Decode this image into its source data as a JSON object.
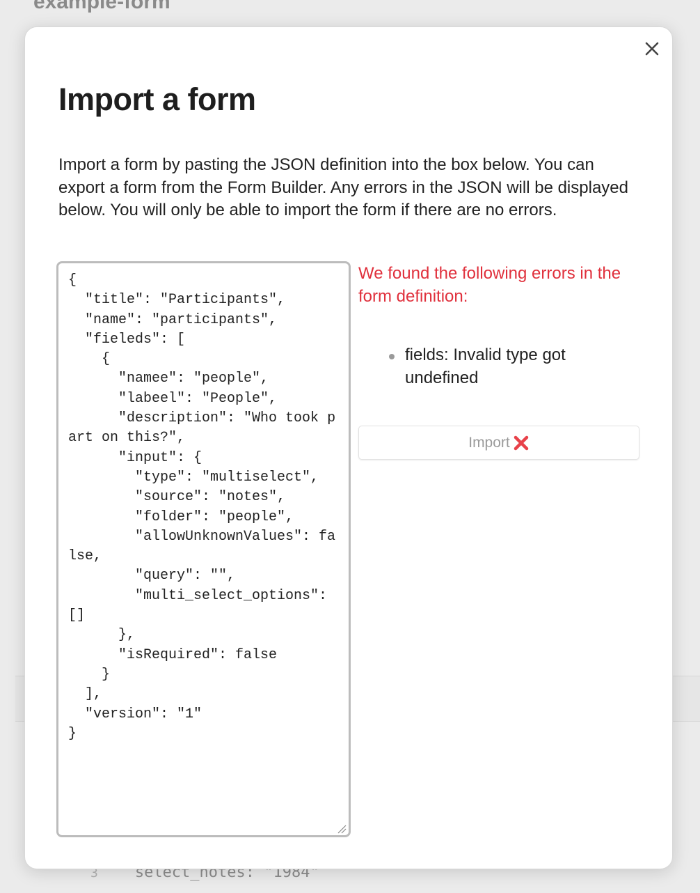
{
  "background": {
    "title": "example-form",
    "code_line_number": "3",
    "code_line_text": "select_notes: \"1984\""
  },
  "modal": {
    "close_icon": "close-icon",
    "title": "Import a form",
    "description": "Import a form by pasting the JSON definition into the box below. You can export a form from the Form Builder. Any errors in the JSON will be displayed below. You will only be able to import the form if there are no errors.",
    "json_value": "{\n  \"title\": \"Participants\",\n  \"name\": \"participants\",\n  \"fieleds\": [\n    {\n      \"namee\": \"people\",\n      \"labeel\": \"People\",\n      \"description\": \"Who took part on this?\",\n      \"input\": {\n        \"type\": \"multiselect\",\n        \"source\": \"notes\",\n        \"folder\": \"people\",\n        \"allowUnknownValues\": false,\n        \"query\": \"\",\n        \"multi_select_options\": []\n      },\n      \"isRequired\": false\n    }\n  ],\n  \"version\": \"1\"\n}",
    "errors_heading": "We found the following errors in the form definition:",
    "errors": [
      "fields: Invalid type got undefined"
    ],
    "import_label": "Import",
    "import_icon": "cross-mark-icon",
    "error_color": "#e0303c",
    "cross_color": "#e8424a"
  }
}
